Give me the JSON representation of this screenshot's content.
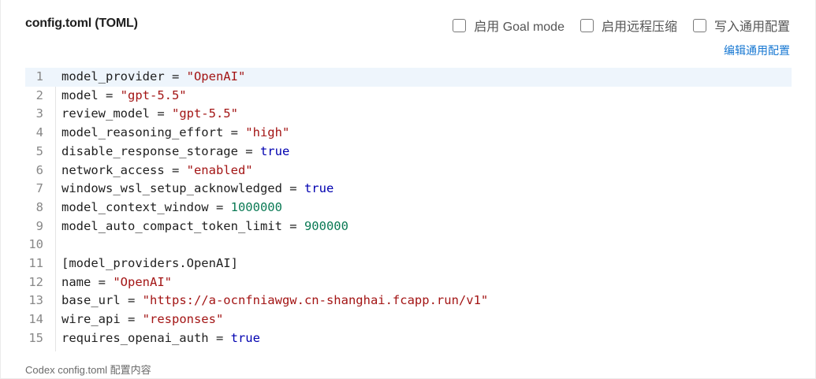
{
  "header": {
    "title": "config.toml (TOML)",
    "options": [
      {
        "label": "启用 Goal mode",
        "checked": false
      },
      {
        "label": "启用远程压缩",
        "checked": false
      },
      {
        "label": "写入通用配置",
        "checked": false
      }
    ],
    "edit_link": "编辑通用配置"
  },
  "editor": {
    "active_line": 1,
    "lines": [
      {
        "n": "1",
        "tokens": [
          {
            "t": "model_provider = ",
            "k": "plain"
          },
          {
            "t": "\"OpenAI\"",
            "k": "str"
          }
        ]
      },
      {
        "n": "2",
        "tokens": [
          {
            "t": "model = ",
            "k": "plain"
          },
          {
            "t": "\"gpt-5.5\"",
            "k": "str"
          }
        ]
      },
      {
        "n": "3",
        "tokens": [
          {
            "t": "review_model = ",
            "k": "plain"
          },
          {
            "t": "\"gpt-5.5\"",
            "k": "str"
          }
        ]
      },
      {
        "n": "4",
        "tokens": [
          {
            "t": "model_reasoning_effort = ",
            "k": "plain"
          },
          {
            "t": "\"high\"",
            "k": "str"
          }
        ]
      },
      {
        "n": "5",
        "tokens": [
          {
            "t": "disable_response_storage = ",
            "k": "plain"
          },
          {
            "t": "true",
            "k": "bool"
          }
        ]
      },
      {
        "n": "6",
        "tokens": [
          {
            "t": "network_access = ",
            "k": "plain"
          },
          {
            "t": "\"enabled\"",
            "k": "str"
          }
        ]
      },
      {
        "n": "7",
        "tokens": [
          {
            "t": "windows_wsl_setup_acknowledged = ",
            "k": "plain"
          },
          {
            "t": "true",
            "k": "bool"
          }
        ]
      },
      {
        "n": "8",
        "tokens": [
          {
            "t": "model_context_window = ",
            "k": "plain"
          },
          {
            "t": "1000000",
            "k": "num"
          }
        ]
      },
      {
        "n": "9",
        "tokens": [
          {
            "t": "model_auto_compact_token_limit = ",
            "k": "plain"
          },
          {
            "t": "900000",
            "k": "num"
          }
        ]
      },
      {
        "n": "10",
        "tokens": []
      },
      {
        "n": "11",
        "tokens": [
          {
            "t": "[model_providers.OpenAI]",
            "k": "plain"
          }
        ]
      },
      {
        "n": "12",
        "tokens": [
          {
            "t": "name = ",
            "k": "plain"
          },
          {
            "t": "\"OpenAI\"",
            "k": "str"
          }
        ]
      },
      {
        "n": "13",
        "tokens": [
          {
            "t": "base_url = ",
            "k": "plain"
          },
          {
            "t": "\"https://a-ocnfniawgw.cn-shanghai.fcapp.run/v1\"",
            "k": "str"
          }
        ]
      },
      {
        "n": "14",
        "tokens": [
          {
            "t": "wire_api = ",
            "k": "plain"
          },
          {
            "t": "\"responses\"",
            "k": "str"
          }
        ]
      },
      {
        "n": "15",
        "tokens": [
          {
            "t": "requires_openai_auth = ",
            "k": "plain"
          },
          {
            "t": "true",
            "k": "bool"
          }
        ]
      }
    ]
  },
  "footer": {
    "caption": "Codex config.toml 配置内容"
  },
  "colors": {
    "string": "#a31515",
    "boolean": "#0000b0",
    "number": "#0b7a55",
    "link": "#1677d2",
    "active_line": "#eef5fc"
  }
}
